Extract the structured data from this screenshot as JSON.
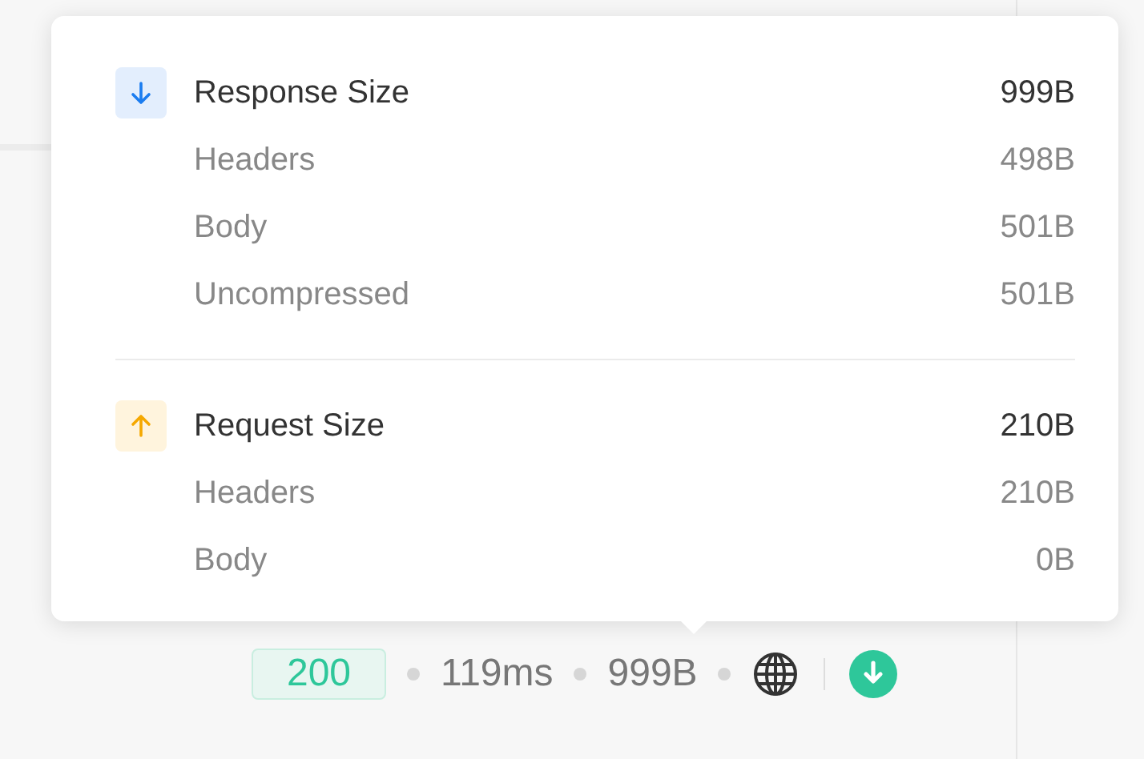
{
  "size_popover": {
    "sections": [
      {
        "kind": "response",
        "title": "Response Size",
        "value": "999B",
        "rows": [
          {
            "label": "Headers",
            "value": "498B"
          },
          {
            "label": "Body",
            "value": "501B"
          },
          {
            "label": "Uncompressed",
            "value": "501B"
          }
        ]
      },
      {
        "kind": "request",
        "title": "Request Size",
        "value": "210B",
        "rows": [
          {
            "label": "Headers",
            "value": "210B"
          },
          {
            "label": "Body",
            "value": "0B"
          }
        ]
      }
    ]
  },
  "status_bar": {
    "status_code": "200",
    "time": "119ms",
    "size": "999B"
  }
}
